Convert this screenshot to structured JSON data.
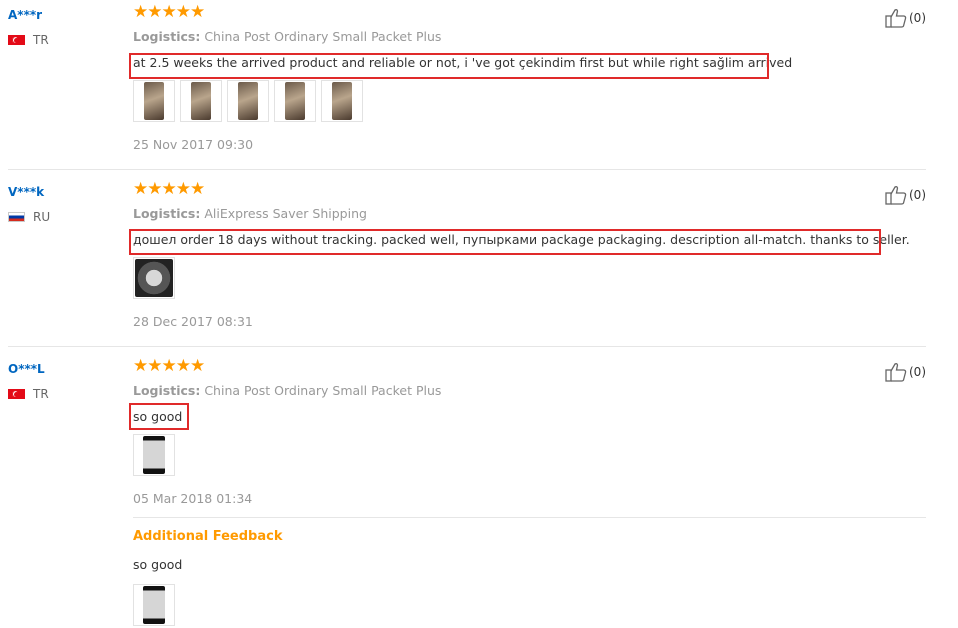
{
  "reviews": [
    {
      "user": "A***r",
      "country": "TR",
      "stars": "★★★★★",
      "logistics_label": "Logistics:",
      "logistics_value": "China Post Ordinary Small Packet Plus",
      "text": "at 2.5 weeks the arrived product and reliable or not, i 've got çekindim first but while right sağlim arrived",
      "date": "25 Nov 2017 09:30",
      "helpful": "(0)",
      "photo_count": 5
    },
    {
      "user": "V***k",
      "country": "RU",
      "stars": "★★★★★",
      "logistics_label": "Logistics:",
      "logistics_value": "AliExpress Saver Shipping",
      "text": "дошел order 18 days without tracking. packed well, пупырками package packaging. description all-match. thanks to seller.",
      "date": "28 Dec 2017 08:31",
      "helpful": "(0)",
      "photo_count": 1
    },
    {
      "user": "O***L",
      "country": "TR",
      "stars": "★★★★★",
      "logistics_label": "Logistics:",
      "logistics_value": "China Post Ordinary Small Packet Plus",
      "text": "so good",
      "date": "05 Mar 2018 01:34",
      "helpful": "(0)",
      "photo_count": 1,
      "additional_feedback": {
        "title": "Additional Feedback",
        "text": "so good",
        "photo_count": 1
      }
    }
  ],
  "colors": {
    "username": "#0066c0",
    "star": "#ff9a00",
    "highlight": "#e02a2a",
    "muted": "#999999",
    "additional": "#ff9a00"
  },
  "icons": {
    "helpful": "thumbs-up-icon",
    "flag_tr": "flag-tr-icon",
    "flag_ru": "flag-ru-icon"
  }
}
